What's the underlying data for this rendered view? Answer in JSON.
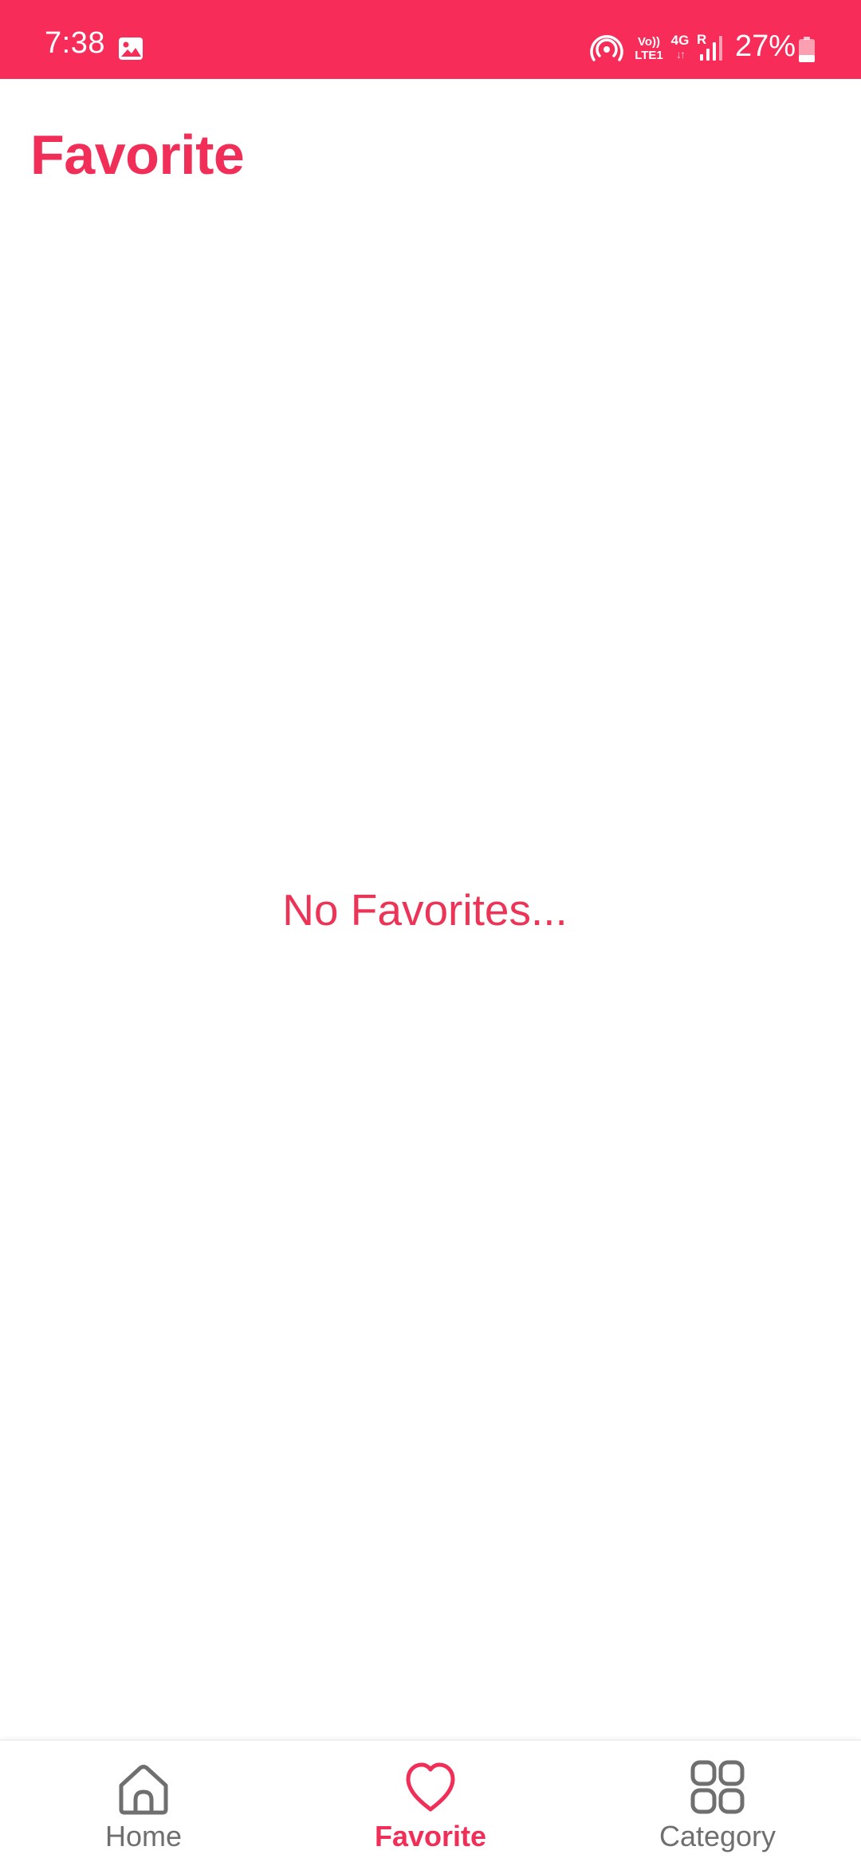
{
  "status_bar": {
    "time": "7:38",
    "gallery_icon": "image-icon",
    "hotspot_icon": "hotspot-icon",
    "volte_line1": "Vo))",
    "volte_line2": "LTE1",
    "network_type": "4G",
    "network_arrows": "↓↑",
    "roaming_indicator": "R",
    "signal_icon": "signal-bars-icon",
    "battery_percent": "27%",
    "battery_icon": "battery-icon",
    "background_color": "#f72c58"
  },
  "header": {
    "title": "Favorite"
  },
  "main": {
    "empty_message": "No Favorites..."
  },
  "bottom_nav": {
    "items": [
      {
        "label": "Home",
        "icon": "home-icon",
        "active": false
      },
      {
        "label": "Favorite",
        "icon": "heart-icon",
        "active": true
      },
      {
        "label": "Category",
        "icon": "grid-icon",
        "active": false
      }
    ]
  },
  "colors": {
    "accent": "#f02e58",
    "inactive": "#6f6f6f",
    "background": "#ffffff"
  }
}
